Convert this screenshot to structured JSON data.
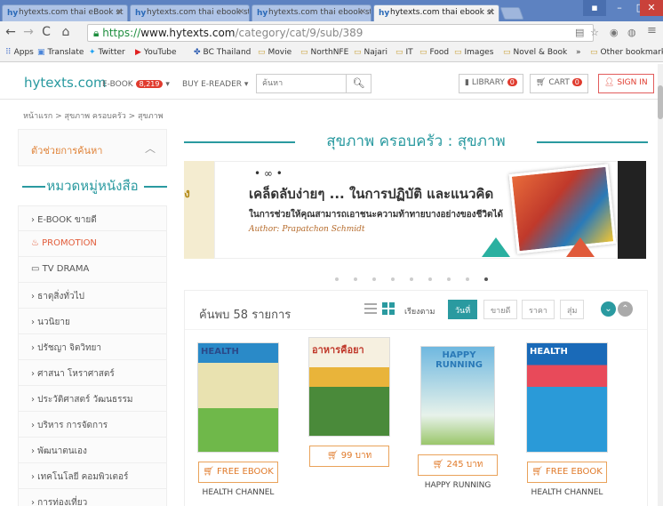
{
  "browser": {
    "tabs": [
      {
        "title": "hytexts.com thai eBook st"
      },
      {
        "title": "hytexts.com thai ebook st"
      },
      {
        "title": "hytexts.com thai ebook st"
      },
      {
        "title": "hytexts.com thai ebook st"
      }
    ],
    "url_secure": "https://",
    "url_host": "www.hytexts.com",
    "url_path": "/category/cat/9/sub/389",
    "bookmarks": [
      "Apps",
      "Translate",
      "Twitter",
      "YouTube",
      "BC Thailand",
      "Movie",
      "NorthNFE",
      "Najari",
      "IT",
      "Food",
      "Images",
      "Novel & Book",
      "»",
      "Other bookmarks"
    ]
  },
  "header": {
    "logo": "hytexts.com",
    "ebook_label": "E-BOOK",
    "ebook_count": "8,219",
    "buy_reader": "BUY E-READER ▾",
    "search_placeholder": "ค้นหา",
    "library": "LIBRARY",
    "library_count": "0",
    "cart": "CART",
    "cart_count": "0",
    "signin": "SIGN IN"
  },
  "breadcrumb": "หน้าแรก > สุขภาพ ครอบครัว > สุขภาพ",
  "sidebar": {
    "help_title": "ตัวช่วยการค้นหา",
    "category_title": "หมวดหมู่หนังสือ",
    "items": [
      {
        "label": "› E-BOOK ขายดี"
      },
      {
        "label": "PROMOTION"
      },
      {
        "label": "TV DRAMA"
      },
      {
        "label": "› ธาตุสิ่งทั่วไป"
      },
      {
        "label": "› นวนิยาย"
      },
      {
        "label": "› ปรัชญา จิตวิทยา"
      },
      {
        "label": "› ศาสนา โหราศาสตร์"
      },
      {
        "label": "› ประวัติศาสตร์ วัฒนธรรม"
      },
      {
        "label": "› บริหาร การจัดการ"
      },
      {
        "label": "› พัฒนาตนเอง"
      },
      {
        "label": "› เทคโนโลยี คอมพิวเตอร์"
      },
      {
        "label": "› การท่องเที่ยว"
      }
    ]
  },
  "main": {
    "section_title": "สุขภาพ ครอบครัว : สุขภาพ",
    "banner": {
      "left_text": "ิ่ง",
      "logo_mark": "• ∞ •",
      "headline": "เคล็ดลับง่ายๆ ... ในการปฏิบัติ และแนวคิด",
      "subline": "ในการช่วยให้คุณสามารถเอาชนะความท้าทายบางอย่างของชีวิตได้",
      "author": "Author: Prapatchon Schmidt"
    },
    "result_count": "ค้นพบ 58 รายการ",
    "sort_label": "เรียงตาม",
    "sort_options": [
      "วันที่",
      "ขายดี",
      "ราคา",
      "สุ่ม"
    ],
    "books": [
      {
        "cover_title": "HEALTH",
        "price": "FREE EBOOK",
        "name": "HEALTH CHANNEL"
      },
      {
        "cover_title": "อาหารคือยา",
        "price": "99 บาท",
        "name": ""
      },
      {
        "cover_title": "HAPPY RUNNING",
        "price": "245 บาท",
        "name": "HAPPY RUNNING"
      },
      {
        "cover_title": "HEALTH",
        "price": "FREE EBOOK",
        "name": "HEALTH CHANNEL"
      }
    ]
  }
}
